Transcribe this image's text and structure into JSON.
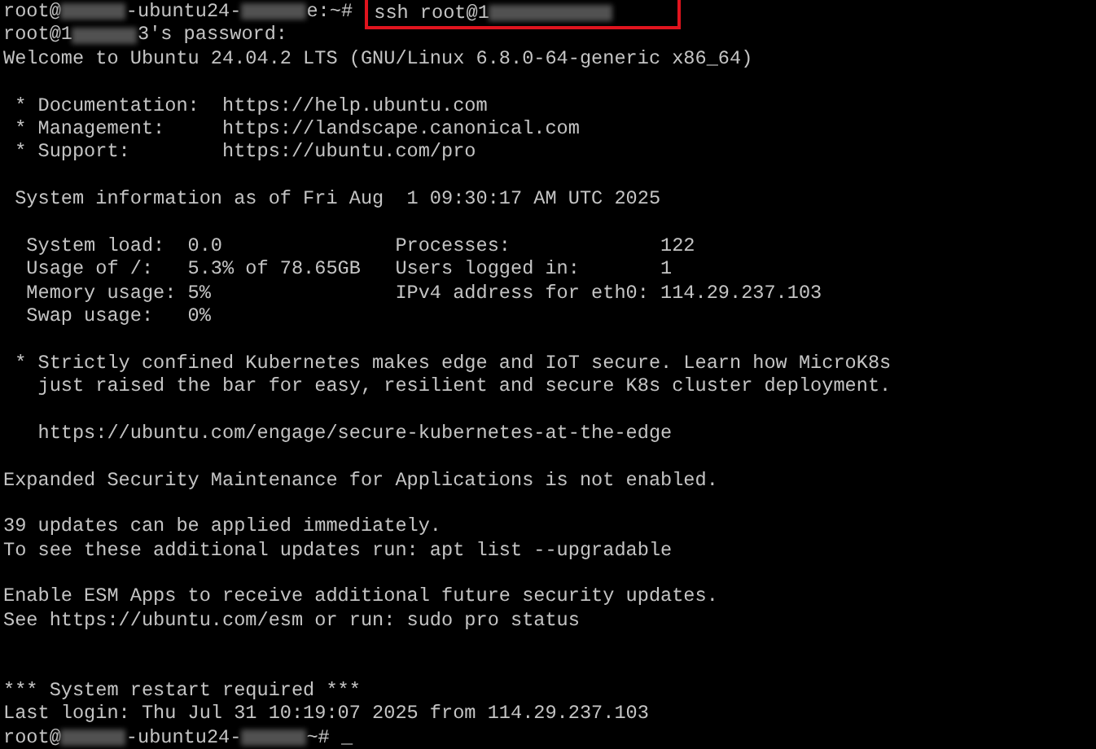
{
  "terminal": {
    "lines": [
      {
        "kind": "mixed",
        "segments": [
          {
            "kind": "text",
            "text": "root@"
          },
          {
            "kind": "blur"
          },
          {
            "kind": "text",
            "text": "-ubuntu24-"
          },
          {
            "kind": "blur"
          },
          {
            "kind": "text",
            "text": "e:~# "
          },
          {
            "kind": "highlight",
            "segments": [
              {
                "kind": "text",
                "text": "ssh root@1"
              },
              {
                "kind": "blur"
              }
            ]
          }
        ]
      },
      {
        "kind": "mixed",
        "segments": [
          {
            "kind": "text",
            "text": "root@1"
          },
          {
            "kind": "blur"
          },
          {
            "kind": "text",
            "text": "3's password:"
          }
        ]
      },
      {
        "kind": "text",
        "text": "Welcome to Ubuntu 24.04.2 LTS (GNU/Linux 6.8.0-64-generic x86_64)"
      },
      {
        "kind": "blank"
      },
      {
        "kind": "text",
        "text": " * Documentation:  https://help.ubuntu.com"
      },
      {
        "kind": "text",
        "text": " * Management:     https://landscape.canonical.com"
      },
      {
        "kind": "text",
        "text": " * Support:        https://ubuntu.com/pro"
      },
      {
        "kind": "blank"
      },
      {
        "kind": "text",
        "text": " System information as of Fri Aug  1 09:30:17 AM UTC 2025"
      },
      {
        "kind": "blank"
      },
      {
        "kind": "text",
        "text": "  System load:  0.0               Processes:             122"
      },
      {
        "kind": "text",
        "text": "  Usage of /:   5.3% of 78.65GB   Users logged in:       1"
      },
      {
        "kind": "text",
        "text": "  Memory usage: 5%                IPv4 address for eth0: 114.29.237.103"
      },
      {
        "kind": "text",
        "text": "  Swap usage:   0%"
      },
      {
        "kind": "blank"
      },
      {
        "kind": "text",
        "text": " * Strictly confined Kubernetes makes edge and IoT secure. Learn how MicroK8s"
      },
      {
        "kind": "text",
        "text": "   just raised the bar for easy, resilient and secure K8s cluster deployment."
      },
      {
        "kind": "blank"
      },
      {
        "kind": "text",
        "text": "   https://ubuntu.com/engage/secure-kubernetes-at-the-edge"
      },
      {
        "kind": "blank"
      },
      {
        "kind": "text",
        "text": "Expanded Security Maintenance for Applications is not enabled."
      },
      {
        "kind": "blank"
      },
      {
        "kind": "text",
        "text": "39 updates can be applied immediately."
      },
      {
        "kind": "text",
        "text": "To see these additional updates run: apt list --upgradable"
      },
      {
        "kind": "blank"
      },
      {
        "kind": "text",
        "text": "Enable ESM Apps to receive additional future security updates."
      },
      {
        "kind": "text",
        "text": "See https://ubuntu.com/esm or run: sudo pro status"
      },
      {
        "kind": "blank"
      },
      {
        "kind": "blank"
      },
      {
        "kind": "text",
        "text": "*** System restart required ***"
      },
      {
        "kind": "text",
        "text": "Last login: Thu Jul 31 10:19:07 2025 from 114.29.237.103"
      },
      {
        "kind": "mixed",
        "segments": [
          {
            "kind": "text",
            "text": "root@"
          },
          {
            "kind": "blur"
          },
          {
            "kind": "text",
            "text": "-ubuntu24-"
          },
          {
            "kind": "blur"
          },
          {
            "kind": "text",
            "text": "~# _"
          }
        ]
      }
    ]
  }
}
